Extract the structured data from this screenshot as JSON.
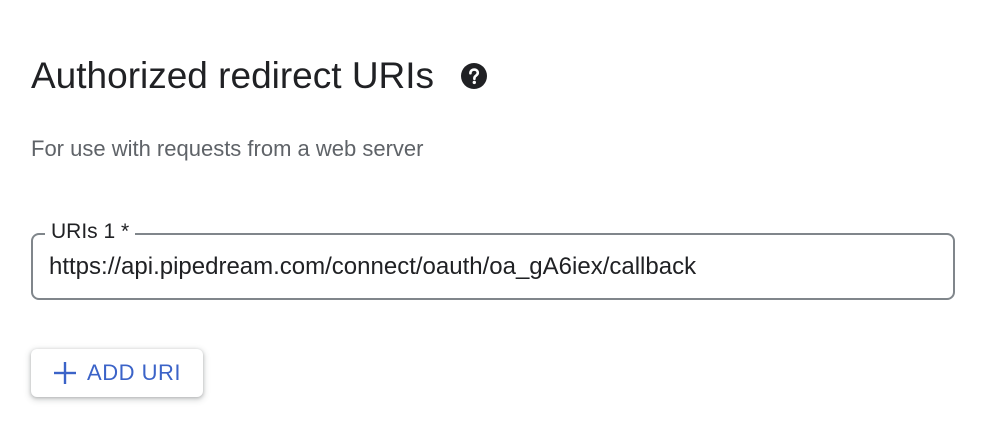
{
  "section": {
    "title": "Authorized redirect URIs",
    "help_icon": "help-circle-icon",
    "subtitle": "For use with requests from a web server"
  },
  "uri_field": {
    "label": "URIs 1 *",
    "value": "https://api.pipedream.com/connect/oauth/oa_gA6iex/callback"
  },
  "add_button": {
    "label": "ADD URI",
    "icon": "plus-icon"
  },
  "colors": {
    "accent": "#3b63c8",
    "text": "#202124",
    "muted": "#5f6368",
    "border": "#80868b"
  }
}
